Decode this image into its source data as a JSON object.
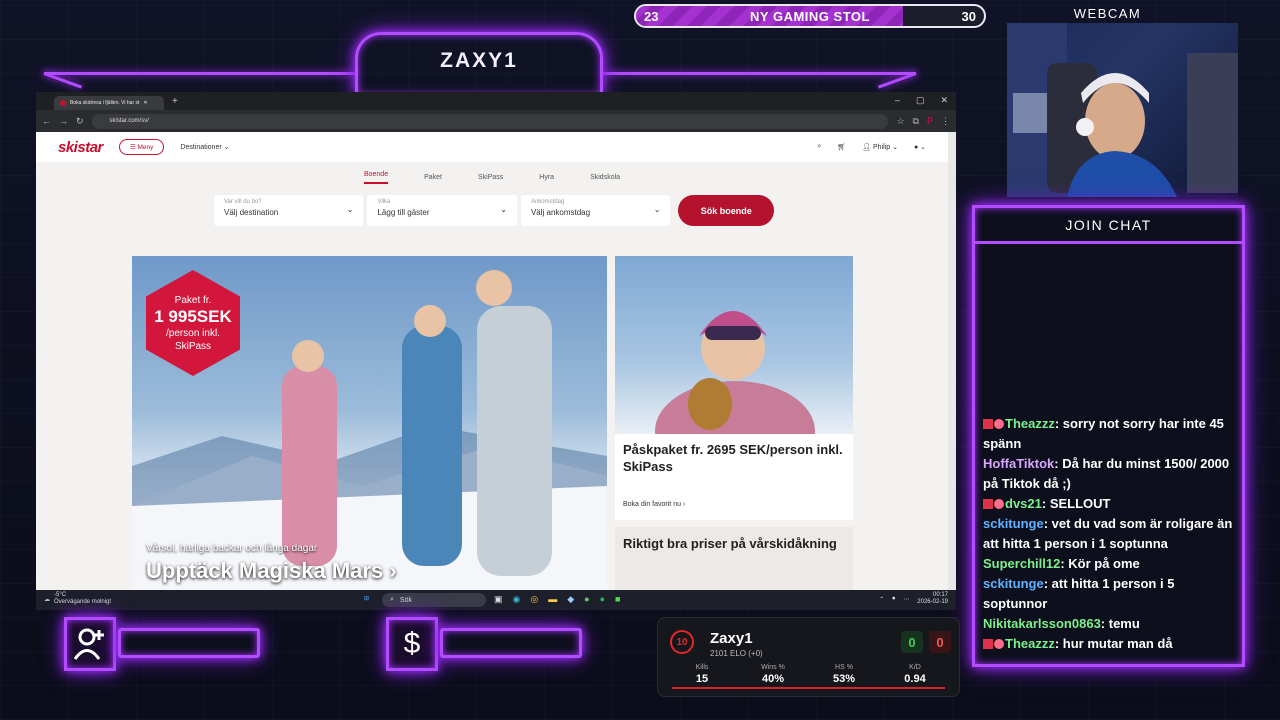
{
  "overlay": {
    "streamer_name": "ZAXY1",
    "webcam_label": "WEBCAM",
    "goal": {
      "current": "23",
      "target": "30",
      "label": "NY GAMING STOL",
      "progress": 0.767
    },
    "accent_color": "#b14cff"
  },
  "chat": {
    "header": "JOIN CHAT",
    "messages": [
      {
        "user": "Theazzz",
        "color": "#7cf08a",
        "badges": true,
        "text": "sorry not sorry har inte 45 spänn"
      },
      {
        "user": "HoffaTiktok",
        "color": "#d9a6ff",
        "badges": false,
        "text": "Då har du minst 1500/ 2000 på Tiktok då ;)"
      },
      {
        "user": "dvs21",
        "color": "#7cf08a",
        "badges": true,
        "text": "SELLOUT"
      },
      {
        "user": "sckitunge",
        "color": "#5fb3ff",
        "badges": false,
        "text": "vet du vad som är roligare än att hitta 1 person i 1 soptunna"
      },
      {
        "user": "Superchill12",
        "color": "#7cf08a",
        "badges": false,
        "text": "Kör på ome"
      },
      {
        "user": "sckitunge",
        "color": "#5fb3ff",
        "badges": false,
        "text": "att hitta 1 person i 5 soptunnor"
      },
      {
        "user": "Nikitakarlsson0863",
        "color": "#7cf08a",
        "badges": false,
        "text": "temu"
      },
      {
        "user": "Theazzz",
        "color": "#7cf08a",
        "badges": true,
        "text": "hur mutar man då"
      }
    ]
  },
  "browser": {
    "tab_title": "Boka skidresa i fjällen. Vi har st",
    "url": "skistar.com/sv/"
  },
  "site": {
    "logo": "skistar",
    "menu_label": "Meny",
    "destinations_label": "Destinationer",
    "user_name": "Philip",
    "tabs": [
      "Boende",
      "Paket",
      "SkiPass",
      "Hyra",
      "Skidskola"
    ],
    "search": {
      "fields": [
        {
          "label": "Var vill du bo?",
          "value": "Välj destination"
        },
        {
          "label": "Vilka",
          "value": "Lägg till gäster"
        },
        {
          "label": "Ankomstdag",
          "value": "Välj ankomstdag"
        }
      ],
      "button": "Sök boende"
    },
    "hero": {
      "badge_line1": "Paket fr.",
      "badge_price": "1 995SEK",
      "badge_line2": "/person inkl.",
      "badge_line3": "SkiPass",
      "subtitle": "Vårsol, härliga backar och långa dagar",
      "title": "Upptäck Magiska Mars"
    },
    "card1": {
      "title": "Påskpaket fr. 2695 SEK/person inkl. SkiPass",
      "link": "Boka din favorit nu"
    },
    "card2": {
      "title": "Riktigt bra priser på vårskidåkning"
    },
    "brand_color": "#c8102e"
  },
  "taskbar": {
    "temperature": "-5°C",
    "weather": "Övervägande molnigt",
    "search_placeholder": "Sök",
    "time": "00:17",
    "date": "2026-02-19"
  },
  "stats": {
    "level": "10",
    "player": "Zaxy1",
    "elo": "2101 ELO (+0)",
    "wins_today": "0",
    "losses_today": "0",
    "columns": [
      {
        "label": "Kills",
        "value": "15"
      },
      {
        "label": "Wins %",
        "value": "40%"
      },
      {
        "label": "HS %",
        "value": "53%"
      },
      {
        "label": "K/D",
        "value": "0.94"
      }
    ]
  }
}
